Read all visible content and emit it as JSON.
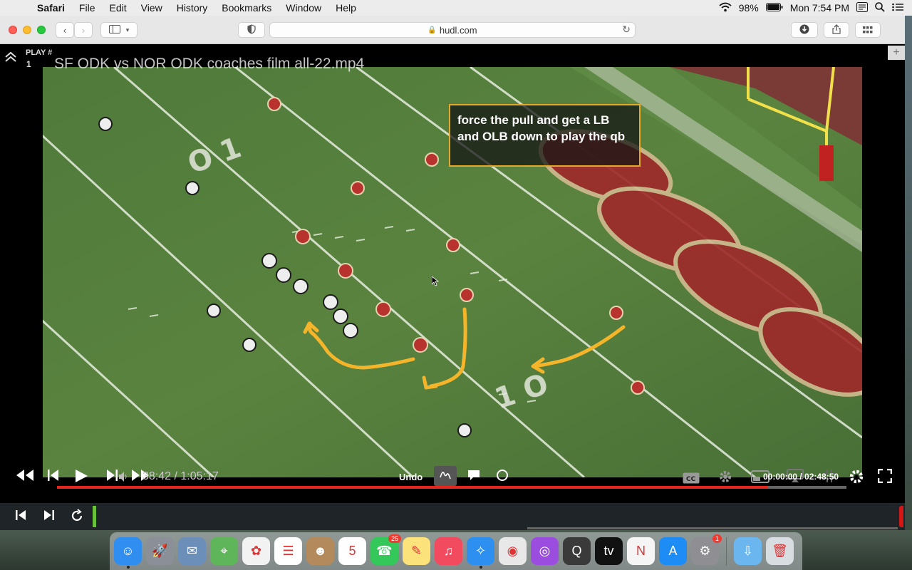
{
  "menubar": {
    "app_name": "Safari",
    "items": [
      "File",
      "Edit",
      "View",
      "History",
      "Bookmarks",
      "Window",
      "Help"
    ],
    "battery": "98%",
    "clock": "Mon 7:54 PM"
  },
  "browser": {
    "url": "hudl.com"
  },
  "player": {
    "play_label": "PLAY #",
    "play_number": "1",
    "video_title": "SF ODK vs NOR ODK coaches film all-22.mp4",
    "annotation_text": "force the pull and get a LB and OLB down to play the qb",
    "annotation_color": "#e4a92b",
    "drawing_color": "#f5b52a",
    "progress_fraction": 0.9,
    "time_main": "38:42 / 1:05:17",
    "undo_label": "Undo",
    "clip_time": "00:00:00 / 02:48:50",
    "cc_label": "CC"
  },
  "dock": {
    "items": [
      {
        "name": "finder",
        "color": "#2f8ef0",
        "glyph": "☺"
      },
      {
        "name": "launchpad",
        "color": "#8a8f98",
        "glyph": "🚀"
      },
      {
        "name": "preview",
        "color": "#6b8fb8",
        "glyph": "✉"
      },
      {
        "name": "maps",
        "color": "#5fb55a",
        "glyph": "⌖"
      },
      {
        "name": "photos",
        "color": "#f2f2f2",
        "glyph": "✿"
      },
      {
        "name": "reminders",
        "color": "#ffffff",
        "glyph": "☰"
      },
      {
        "name": "contacts",
        "color": "#b38a5c",
        "glyph": "☻"
      },
      {
        "name": "calendar",
        "color": "#ffffff",
        "glyph": "5"
      },
      {
        "name": "facetime",
        "color": "#34c759",
        "glyph": "☎",
        "badge": "25"
      },
      {
        "name": "notes",
        "color": "#fbe27a",
        "glyph": "✎"
      },
      {
        "name": "music",
        "color": "#f24a5f",
        "glyph": "♫"
      },
      {
        "name": "safari",
        "color": "#2d8ff0",
        "glyph": "✧"
      },
      {
        "name": "chrome",
        "color": "#e8e8e8",
        "glyph": "◉"
      },
      {
        "name": "podcasts",
        "color": "#9b4de0",
        "glyph": "◎"
      },
      {
        "name": "quicktime",
        "color": "#3a3a3a",
        "glyph": "Q"
      },
      {
        "name": "apple-tv",
        "color": "#111111",
        "glyph": "tv"
      },
      {
        "name": "news",
        "color": "#f5f5f5",
        "glyph": "N"
      },
      {
        "name": "app-store",
        "color": "#1d8cf5",
        "glyph": "A"
      },
      {
        "name": "system-preferences",
        "color": "#8e8e93",
        "glyph": "⚙",
        "badge": "1"
      },
      {
        "name": "downloads-folder",
        "color": "#6bb6ef",
        "glyph": "⇩"
      },
      {
        "name": "trash",
        "color": "#d8dde2",
        "glyph": "🗑"
      }
    ]
  }
}
